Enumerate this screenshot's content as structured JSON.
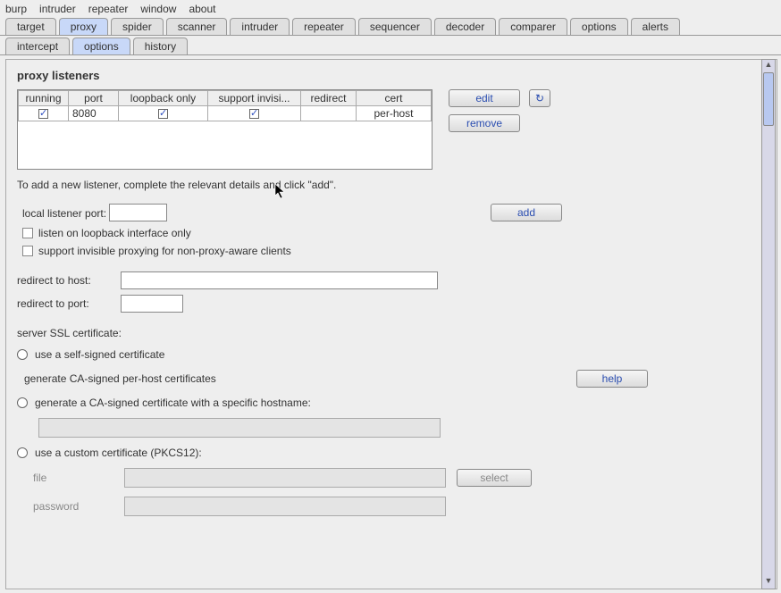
{
  "menu": [
    "burp",
    "intruder",
    "repeater",
    "window",
    "about"
  ],
  "tabs": [
    "target",
    "proxy",
    "spider",
    "scanner",
    "intruder",
    "repeater",
    "sequencer",
    "decoder",
    "comparer",
    "options",
    "alerts"
  ],
  "active_tab": "proxy",
  "sub_tabs": [
    "intercept",
    "options",
    "history"
  ],
  "active_sub_tab": "options",
  "section_title": "proxy listeners",
  "listener_table": {
    "headers": [
      "running",
      "port",
      "loopback only",
      "support invisi...",
      "redirect",
      "cert"
    ],
    "row": {
      "running_checked": true,
      "port": "8080",
      "loopback_checked": true,
      "support_checked": true,
      "redirect": "",
      "cert": "per-host"
    }
  },
  "buttons": {
    "edit": "edit",
    "remove": "remove",
    "refresh_icon": "↻",
    "add": "add",
    "help": "help",
    "select": "select"
  },
  "helper_text": "To add a new listener, complete the relevant details and click \"add\".",
  "form": {
    "local_port_label": "local listener port:",
    "loopback_label": "listen on loopback interface only",
    "invisible_label": "support invisible proxying for non-proxy-aware clients",
    "redirect_host_label": "redirect to host:",
    "redirect_port_label": "redirect to port:"
  },
  "ssl": {
    "title": "server SSL certificate:",
    "opt1": "use a self-signed certificate",
    "opt2": "generate CA-signed per-host certificates",
    "opt3": "generate a CA-signed certificate with a specific hostname:",
    "opt4": "use a custom certificate (PKCS12):",
    "file_label": "file",
    "password_label": "password"
  }
}
